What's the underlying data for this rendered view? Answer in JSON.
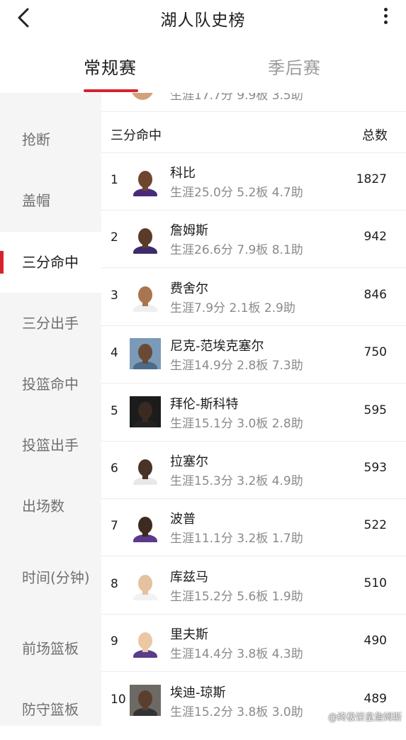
{
  "header": {
    "title": "湖人队史榜"
  },
  "tabs": [
    {
      "label": "常规赛",
      "active": true
    },
    {
      "label": "季后赛",
      "active": false
    }
  ],
  "sidebar": {
    "items": [
      {
        "label": "抢断"
      },
      {
        "label": "盖帽"
      },
      {
        "label": "三分命中",
        "active": true
      },
      {
        "label": "三分出手"
      },
      {
        "label": "投篮命中"
      },
      {
        "label": "投篮出手"
      },
      {
        "label": "出场数"
      },
      {
        "label": "时间(分钟)"
      },
      {
        "label": "前场篮板"
      },
      {
        "label": "防守篮板"
      }
    ]
  },
  "partial_row": {
    "stats": "生涯17.7分 9.9板 3.5助"
  },
  "list": {
    "stat_header": "三分命中",
    "total_header": "总数",
    "rows": [
      {
        "rank": "1",
        "name": "科比",
        "stats": "生涯25.0分 5.2板 4.7助",
        "total": "1827"
      },
      {
        "rank": "2",
        "name": "詹姆斯",
        "stats": "生涯26.6分 7.9板 8.1助",
        "total": "942"
      },
      {
        "rank": "3",
        "name": "费舍尔",
        "stats": "生涯7.9分 2.1板 2.9助",
        "total": "846"
      },
      {
        "rank": "4",
        "name": "尼克-范埃克塞尔",
        "stats": "生涯14.9分 2.8板 7.3助",
        "total": "750"
      },
      {
        "rank": "5",
        "name": "拜伦-斯科特",
        "stats": "生涯15.1分 3.0板 2.8助",
        "total": "595"
      },
      {
        "rank": "6",
        "name": "拉塞尔",
        "stats": "生涯15.3分 3.2板 4.9助",
        "total": "593"
      },
      {
        "rank": "7",
        "name": "波普",
        "stats": "生涯11.1分 3.2板 1.7助",
        "total": "522"
      },
      {
        "rank": "8",
        "name": "库兹马",
        "stats": "生涯15.2分 5.6板 1.9助",
        "total": "510"
      },
      {
        "rank": "9",
        "name": "里夫斯",
        "stats": "生涯14.4分 3.8板 4.3助",
        "total": "490"
      },
      {
        "rank": "10",
        "name": "埃迪-琼斯",
        "stats": "生涯15.2分 3.8板 3.0助",
        "total": "489"
      }
    ]
  },
  "watermark": "@终极饼皇詹姆斯",
  "colors": {
    "accent": "#d5232d",
    "sidebar_bg": "#f5f5f5",
    "muted_text": "#8a8a8a"
  },
  "icons": {
    "back": "chevron-left-icon",
    "more": "vertical-dots-icon"
  }
}
